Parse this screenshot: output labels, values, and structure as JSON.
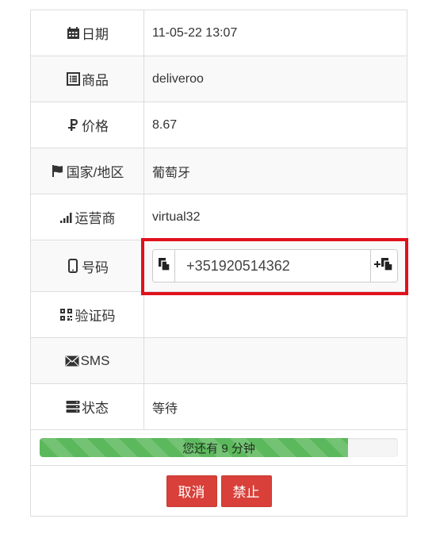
{
  "rows": {
    "date": {
      "label": "日期",
      "value": "11-05-22 13:07",
      "icon": "calendar-icon"
    },
    "product": {
      "label": "商品",
      "value": "deliveroo",
      "icon": "list-icon"
    },
    "price": {
      "label": "价格",
      "value": "8.67",
      "icon": "ruble-icon"
    },
    "country": {
      "label": "国家/地区",
      "value": "葡萄牙",
      "icon": "flag-icon"
    },
    "operator": {
      "label": "运营商",
      "value": "virtual32",
      "icon": "signal-icon"
    },
    "phone": {
      "label": "号码",
      "value": "+351920514362",
      "icon": "mobile-icon"
    },
    "code": {
      "label": "验证码",
      "value": "",
      "icon": "qrcode-icon"
    },
    "sms": {
      "label": "SMS",
      "value": "",
      "icon": "envelope-icon"
    },
    "status": {
      "label": "状态",
      "value": "等待",
      "icon": "server-icon"
    }
  },
  "progress": {
    "text": "您还有 9 分钟",
    "fraction": 0.86,
    "color": "#5cb85c"
  },
  "actions": {
    "cancel": "取消",
    "ban": "禁止"
  },
  "colors": {
    "highlight_border": "#e0111c",
    "button_red": "#d9403a"
  }
}
